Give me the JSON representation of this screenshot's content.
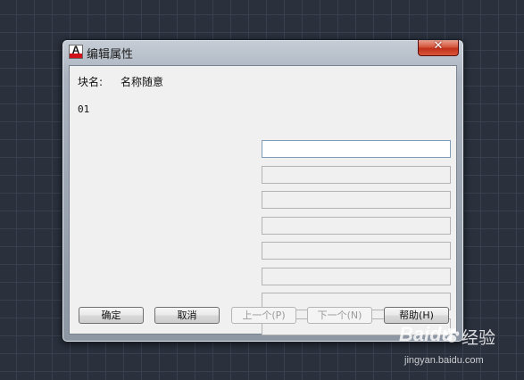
{
  "window": {
    "title": "编辑属性",
    "close_symbol": "✕"
  },
  "block": {
    "label": "块名:",
    "name": "名称随意"
  },
  "attributes": [
    {
      "tag": "01",
      "value": ""
    }
  ],
  "buttons": {
    "ok": "确定",
    "cancel": "取消",
    "previous": "上一个(P)",
    "next": "下一个(N)",
    "help": "帮助(H)"
  },
  "watermark": {
    "brand_text": "Baidu",
    "product": "经验",
    "url": "jingyan.baidu.com"
  },
  "colors": {
    "desktop_bg": "#2a303c",
    "close_button": "#c2301a",
    "app_icon_red": "#d0121b"
  },
  "icons": {
    "app": "autocad-a-icon",
    "close": "close-icon",
    "watermark": "baidu-paw-icon"
  }
}
